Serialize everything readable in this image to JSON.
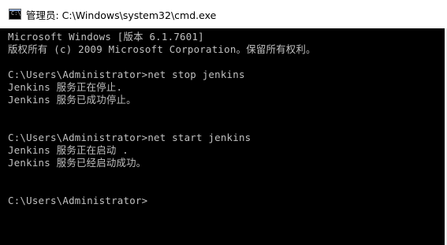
{
  "window": {
    "title": "管理员: C:\\Windows\\system32\\cmd.exe",
    "icon": "cmd-icon"
  },
  "console": {
    "lines": [
      "Microsoft Windows [版本 6.1.7601]",
      "版权所有 (c) 2009 Microsoft Corporation。保留所有权利。",
      "",
      "C:\\Users\\Administrator>net stop jenkins",
      "Jenkins 服务正在停止.",
      "Jenkins 服务已成功停止。",
      "",
      "",
      "C:\\Users\\Administrator>net start jenkins",
      "Jenkins 服务正在启动 .",
      "Jenkins 服务已经启动成功。",
      "",
      "",
      "C:\\Users\\Administrator>"
    ]
  },
  "colors": {
    "console_bg": "#000000",
    "console_text": "#c0c0c0",
    "titlebar_bg": "#ffffff"
  }
}
